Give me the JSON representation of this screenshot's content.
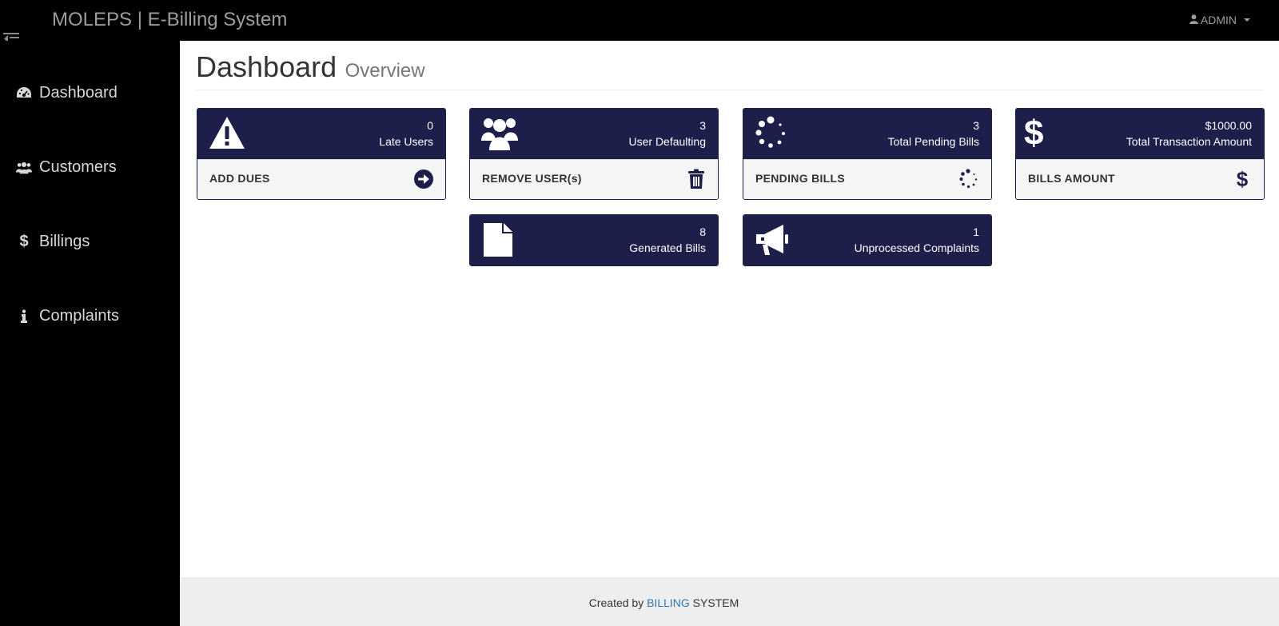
{
  "app": {
    "title": "MOLEPS | E-Billing System"
  },
  "user_menu": {
    "label": "ADMIN"
  },
  "sidebar": {
    "items": [
      {
        "label": "Dashboard",
        "icon": "dashboard-icon"
      },
      {
        "label": "Customers",
        "icon": "users-icon"
      },
      {
        "label": "Billings",
        "icon": "dollar-icon"
      },
      {
        "label": "Complaints",
        "icon": "info-icon"
      }
    ]
  },
  "header": {
    "title": "Dashboard",
    "subtitle": "Overview"
  },
  "cards": {
    "late_users": {
      "value": "0",
      "label": "Late Users",
      "icon": "warning-icon",
      "footer": "ADD DUES",
      "footer_icon": "arrow-circle-right-icon"
    },
    "user_defaulting": {
      "value": "3",
      "label": "User Defaulting",
      "icon": "users-icon",
      "footer": "REMOVE USER(s)",
      "footer_icon": "trash-icon"
    },
    "pending_bills": {
      "value": "3",
      "label": "Total Pending Bills",
      "icon": "spinner-icon",
      "footer": "PENDING BILLS",
      "footer_icon": "spinner-icon"
    },
    "transaction": {
      "value": "$1000.00",
      "label": "Total Transaction Amount",
      "icon": "dollar-icon",
      "footer": "BILLS AMOUNT",
      "footer_icon": "dollar-icon"
    },
    "generated_bills": {
      "value": "8",
      "label": "Generated Bills",
      "icon": "file-icon"
    },
    "complaints": {
      "value": "1",
      "label": "Unprocessed Complaints",
      "icon": "bullhorn-icon"
    }
  },
  "footer": {
    "prefix": "Created by ",
    "link": "BILLING",
    "suffix": " SYSTEM"
  },
  "colors": {
    "panel": "#1e1e4a",
    "nav_bg": "#000000",
    "link": "#337ab7"
  }
}
